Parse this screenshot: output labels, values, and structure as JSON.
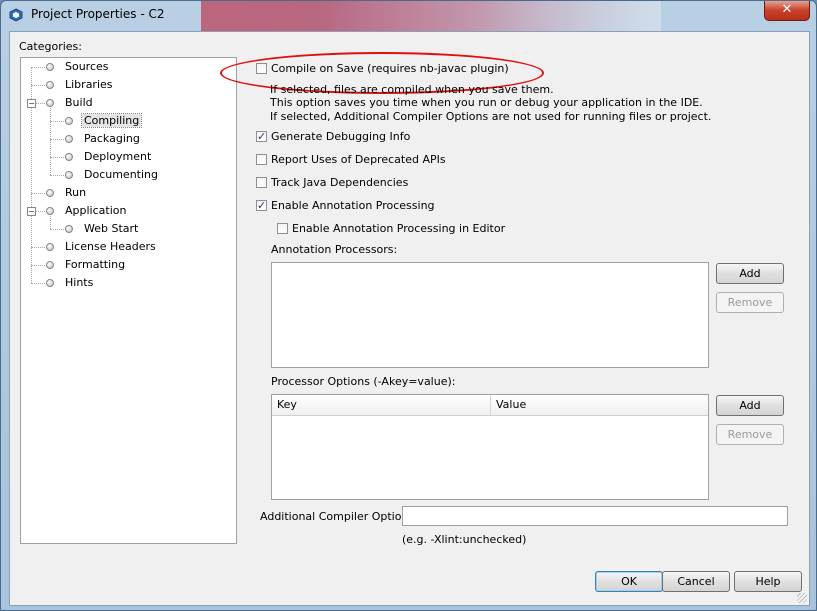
{
  "window": {
    "title": "Project Properties - C2",
    "close_glyph": "✕"
  },
  "categories": {
    "label": "Categories:",
    "items": [
      {
        "label": "Sources",
        "level": 0
      },
      {
        "label": "Libraries",
        "level": 0
      },
      {
        "label": "Build",
        "level": 0,
        "expanded": true
      },
      {
        "label": "Compiling",
        "level": 1,
        "selected": true
      },
      {
        "label": "Packaging",
        "level": 1
      },
      {
        "label": "Deployment",
        "level": 1
      },
      {
        "label": "Documenting",
        "level": 1
      },
      {
        "label": "Run",
        "level": 0
      },
      {
        "label": "Application",
        "level": 0,
        "expanded": true
      },
      {
        "label": "Web Start",
        "level": 1
      },
      {
        "label": "License Headers",
        "level": 0
      },
      {
        "label": "Formatting",
        "level": 0
      },
      {
        "label": "Hints",
        "level": 0
      }
    ],
    "expander_glyph": "−"
  },
  "compiling": {
    "compile_on_save": {
      "label": "Compile on Save (requires nb-javac plugin)",
      "checked": false
    },
    "info_lines": [
      "If selected, files are compiled when you save them.",
      "This option saves you time when you run or debug your application in the IDE.",
      "If selected, Additional Compiler Options are not used for running files or project."
    ],
    "generate_debugging": {
      "label": "Generate Debugging Info",
      "checked": true
    },
    "report_deprecated": {
      "label": "Report Uses of Deprecated APIs",
      "checked": false
    },
    "track_dependencies": {
      "label": "Track Java Dependencies",
      "checked": false
    },
    "enable_annotation": {
      "label": "Enable Annotation Processing",
      "checked": true
    },
    "enable_annotation_editor": {
      "label": "Enable Annotation Processing in Editor",
      "checked": false
    },
    "annotation_processors_label": "Annotation Processors:",
    "processor_options_label": "Processor Options (-Akey=value):",
    "table_columns": [
      "Key",
      "Value"
    ],
    "add_label": "Add",
    "remove_label": "Remove",
    "additional_options_label": "Additional Compiler Options:",
    "additional_options_value": "",
    "additional_options_hint": "(e.g. -Xlint:unchecked)"
  },
  "footer": {
    "ok": "OK",
    "cancel": "Cancel",
    "help": "Help"
  },
  "colors": {
    "annotation_ellipse": "#e01010",
    "checkmark": "#2a3a6a"
  }
}
